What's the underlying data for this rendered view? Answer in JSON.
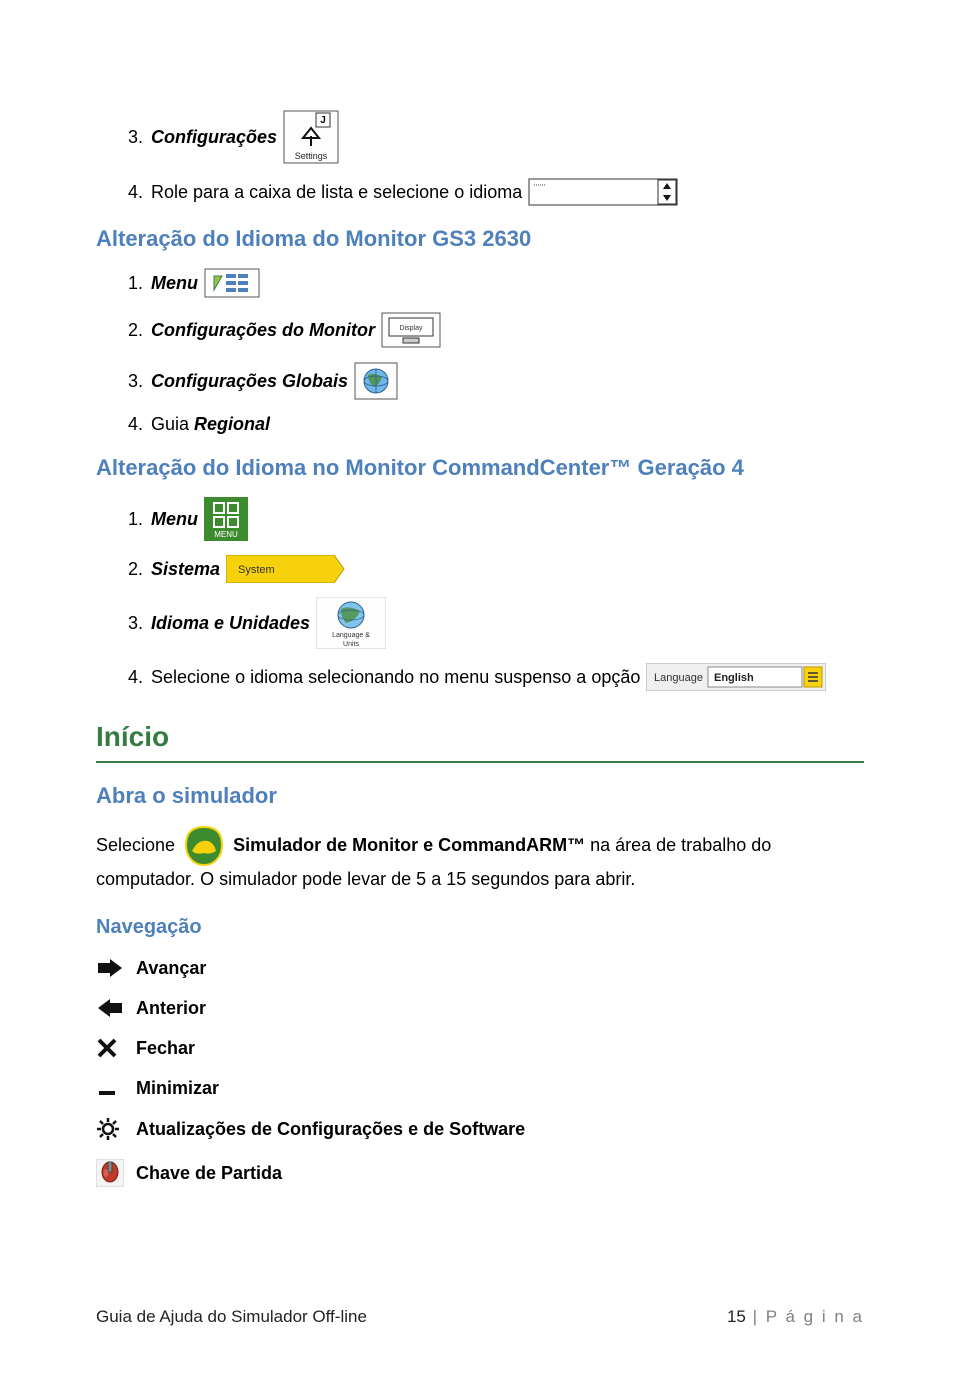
{
  "steps_top": [
    {
      "num": "3.",
      "label": "Configurações"
    },
    {
      "num": "4.",
      "prefix": "Role para a caixa de lista e selecione o idioma ",
      "plain_prefix": true
    }
  ],
  "headings": {
    "gs3": "Alteração do Idioma do Monitor GS3 2630",
    "cc4": "Alteração do Idioma no Monitor CommandCenter™ Geração 4",
    "inicio": "Início",
    "abra": "Abra o simulador",
    "nav": "Navegação"
  },
  "gs3_steps": [
    {
      "num": "1.",
      "label": "Menu"
    },
    {
      "num": "2.",
      "label": "Configurações do Monitor"
    },
    {
      "num": "3.",
      "label": "Configurações Globais"
    },
    {
      "num": "4.",
      "label_prefix": "Guia ",
      "label": "Regional"
    }
  ],
  "cc4_steps": [
    {
      "num": "1.",
      "label": "Menu"
    },
    {
      "num": "2.",
      "label": "Sistema"
    },
    {
      "num": "3.",
      "label": "Idioma e Unidades"
    },
    {
      "num": "4.",
      "label": "Selecione o idioma selecionando no menu suspenso a opção"
    }
  ],
  "selecione_para": {
    "before": "Selecione ",
    "bold": "Simulador de Monitor e CommandARM™",
    "after": " na área de trabalho do computador.  O simulador pode levar de 5 a 15 segundos para abrir."
  },
  "nav_items": [
    {
      "label": "Avançar",
      "bold": true
    },
    {
      "label": "Anterior",
      "bold": true
    },
    {
      "label": "Fechar",
      "bold": true
    },
    {
      "label": "Minimizar",
      "bold": true
    },
    {
      "label": "Atualizações de Configurações e de Software",
      "bold": true
    },
    {
      "label": "Chave de Partida",
      "bold": true
    }
  ],
  "language_dropdown": {
    "label": "Language",
    "value": "English"
  },
  "footer": {
    "left": "Guia de Ajuda do Simulador Off-line",
    "pagenum": "15",
    "pagelabel": " | P á g i n a"
  },
  "icon_labels": {
    "menu_green": "MENU",
    "system": "System",
    "lang_units1": "Language &",
    "lang_units2": "Units",
    "settings": "Settings",
    "display": "Display",
    "key_j": "J"
  }
}
